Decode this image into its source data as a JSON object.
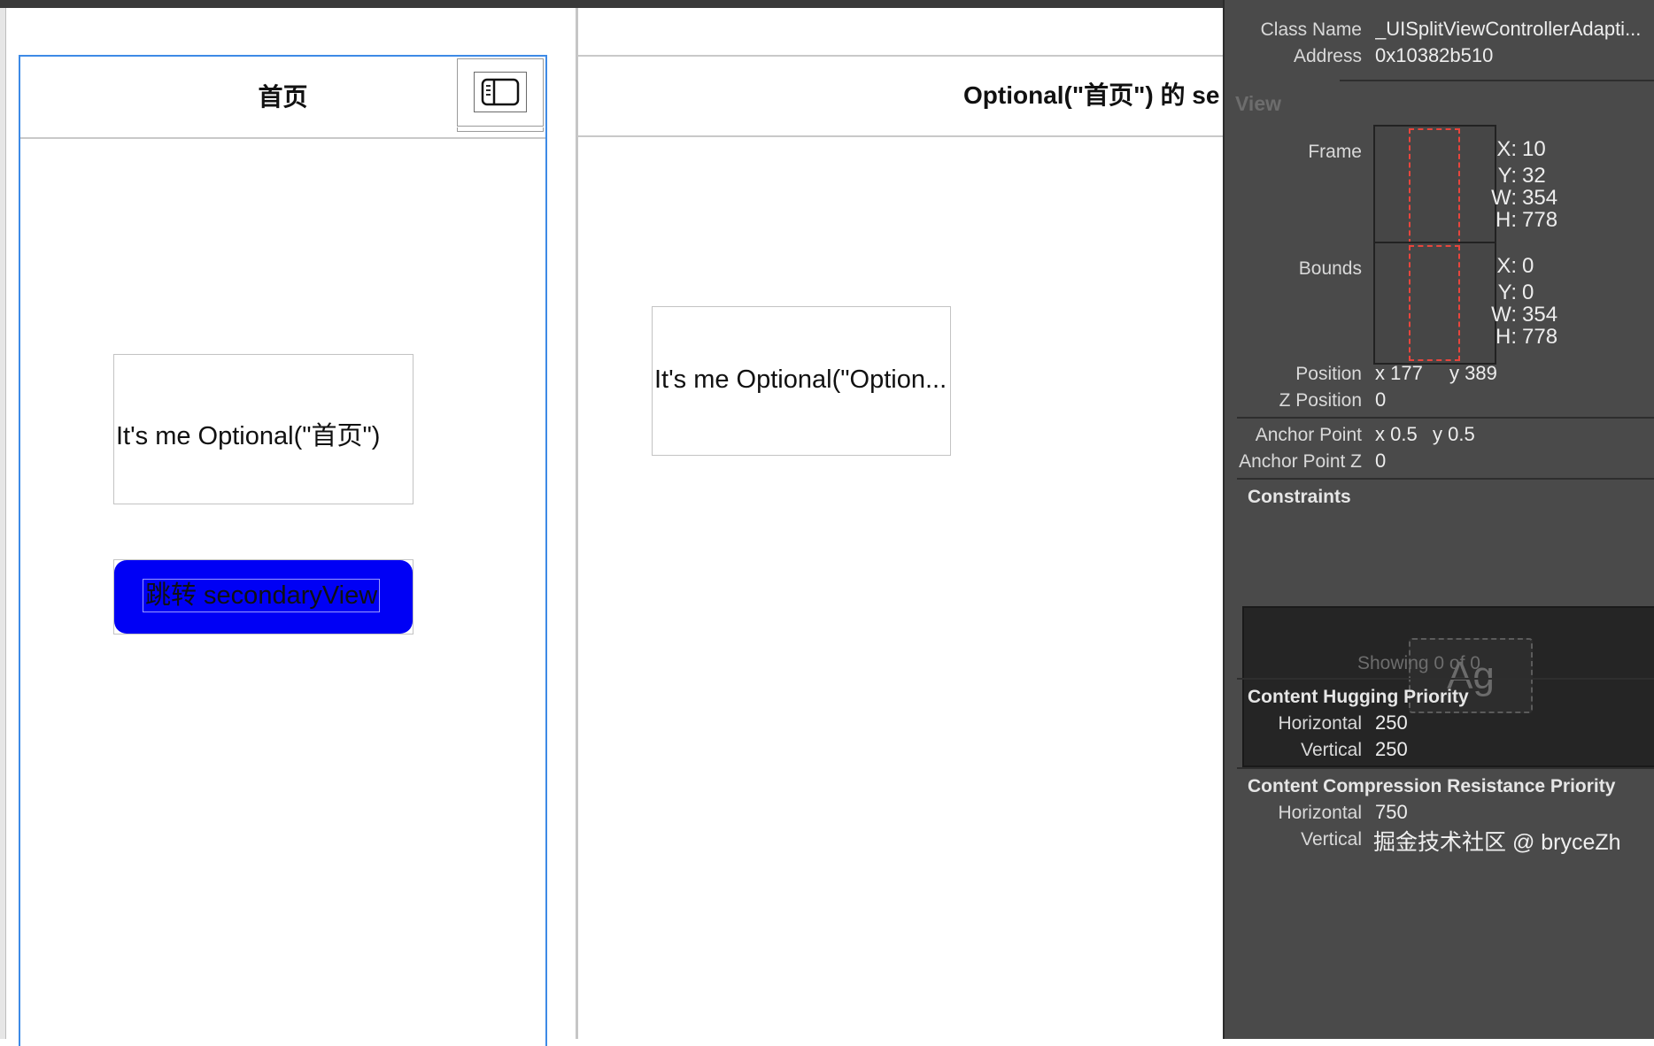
{
  "primary": {
    "title": "首页",
    "label_text": "It's me Optional(\"首页\")",
    "button_label": "跳转 secondaryView"
  },
  "secondary": {
    "title": "Optional(\"首页\") 的 se",
    "label_text": "It's me Optional(\"Option..."
  },
  "inspector": {
    "class_name_label": "Class Name",
    "class_name_value": "_UISplitViewControllerAdapti...",
    "address_label": "Address",
    "address_value": "0x10382b510",
    "view_section": "View",
    "frame_label": "Frame",
    "frame": {
      "x_label": "X:",
      "x": "10",
      "y_label": "Y:",
      "y": "32",
      "w_label": "W:",
      "w": "354",
      "h_label": "H:",
      "h": "778"
    },
    "bounds_label": "Bounds",
    "bounds": {
      "x_label": "X:",
      "x": "0",
      "y_label": "Y:",
      "y": "0",
      "w_label": "W:",
      "w": "354",
      "h_label": "H:",
      "h": "778"
    },
    "position_label": "Position",
    "position_x": "x 177",
    "position_y": "y 389",
    "z_position_label": "Z Position",
    "z_position_value": "0",
    "anchor_point_label": "Anchor Point",
    "anchor_x": "x 0.5",
    "anchor_y": "y 0.5",
    "anchor_z_label": "Anchor Point Z",
    "anchor_z_value": "0",
    "constraints_title": "Constraints",
    "constraints_preview": "Ag",
    "constraints_showing": "Showing 0 of 0",
    "hugging_title": "Content Hugging Priority",
    "hugging_horizontal_label": "Horizontal",
    "hugging_horizontal_value": "250",
    "hugging_vertical_label": "Vertical",
    "hugging_vertical_value": "250",
    "compression_title": "Content Compression Resistance Priority",
    "compression_horizontal_label": "Horizontal",
    "compression_horizontal_value": "750",
    "compression_vertical_label": "Vertical"
  },
  "watermark": "掘金技术社区 @ bryceZh",
  "colors": {
    "accent_selection": "#3d8ae6",
    "button_bg": "#0000f5",
    "inspector_bg": "#4a4a4a",
    "frame_dashed": "#e8453c"
  }
}
